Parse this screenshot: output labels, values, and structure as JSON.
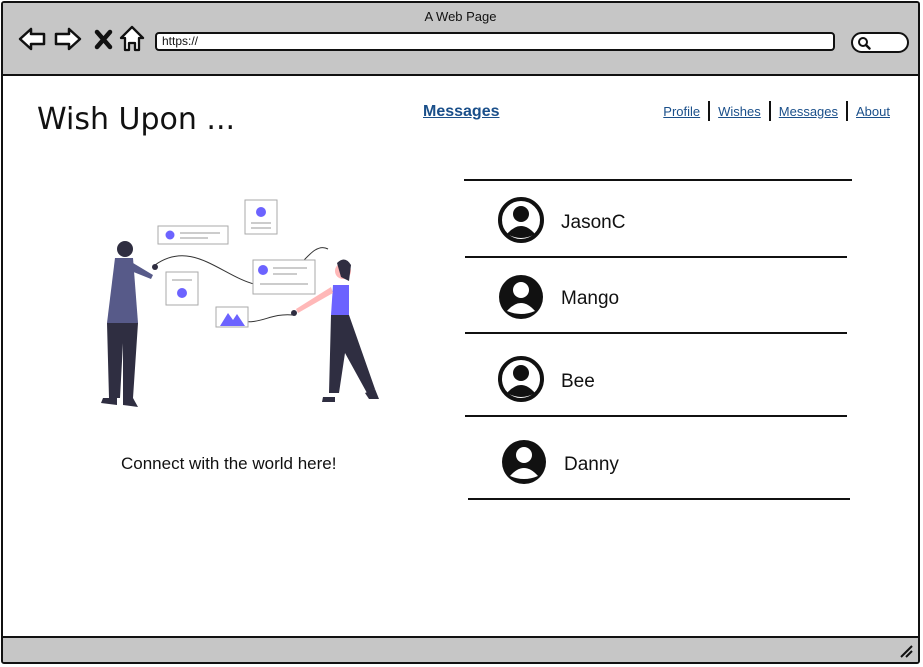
{
  "window": {
    "title": "A Web Page"
  },
  "browser": {
    "url": "https://"
  },
  "header": {
    "brand": "Wish Upon ...",
    "center_link": "Messages"
  },
  "nav": [
    "Profile",
    "Wishes",
    "Messages",
    "About"
  ],
  "illustration": {
    "caption": "Connect with the world here!"
  },
  "contacts": [
    "JasonC",
    "Mango",
    "Bee",
    "Danny"
  ],
  "colors": {
    "accent": "#6c63ff",
    "link": "#1a4f8a",
    "chrome": "#c6c6c6"
  }
}
